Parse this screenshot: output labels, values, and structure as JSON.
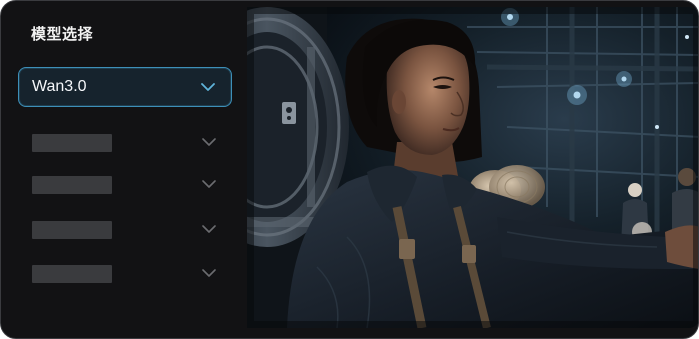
{
  "panel": {
    "title": "模型选择"
  },
  "model_select": {
    "value": "Wan3.0",
    "icon": "chevron-down-icon"
  },
  "placeholder_rows": [
    {
      "icon": "chevron-down-icon"
    },
    {
      "icon": "chevron-down-icon"
    },
    {
      "icon": "chevron-down-icon"
    },
    {
      "icon": "chevron-down-icon"
    }
  ],
  "colors": {
    "background": "#121214",
    "accent_border": "#3d8fb8",
    "placeholder_bar": "#3a3b3e",
    "chevron_active": "#5fb3d9",
    "chevron_muted": "#6b6c70"
  }
}
